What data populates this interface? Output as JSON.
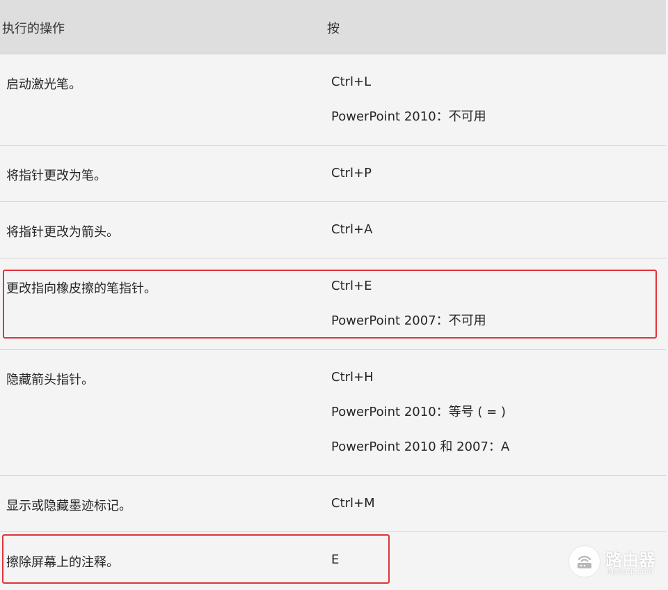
{
  "header": {
    "action": "执行的操作",
    "key": "按"
  },
  "rows": [
    {
      "action": "启动激光笔。",
      "keys": [
        "Ctrl+L",
        "PowerPoint 2010：不可用"
      ]
    },
    {
      "action": "将指针更改为笔。",
      "keys": [
        "Ctrl+P"
      ]
    },
    {
      "action": "将指针更改为箭头。",
      "keys": [
        "Ctrl+A"
      ]
    },
    {
      "action": "更改指向橡皮擦的笔指针。",
      "keys": [
        "Ctrl+E",
        "PowerPoint 2007：不可用"
      ]
    },
    {
      "action": "隐藏箭头指针。",
      "keys": [
        "Ctrl+H",
        "PowerPoint 2010：等号 ( = )",
        "PowerPoint 2010 和 2007：A"
      ]
    },
    {
      "action": "显示或隐藏墨迹标记。",
      "keys": [
        "Ctrl+M"
      ]
    },
    {
      "action": "擦除屏幕上的注释。",
      "keys": [
        "E"
      ]
    }
  ],
  "highlight_color": "#e0343a",
  "watermark": {
    "title": "路由器",
    "subtitle": "luyouqi.com",
    "icon": "router-icon"
  }
}
